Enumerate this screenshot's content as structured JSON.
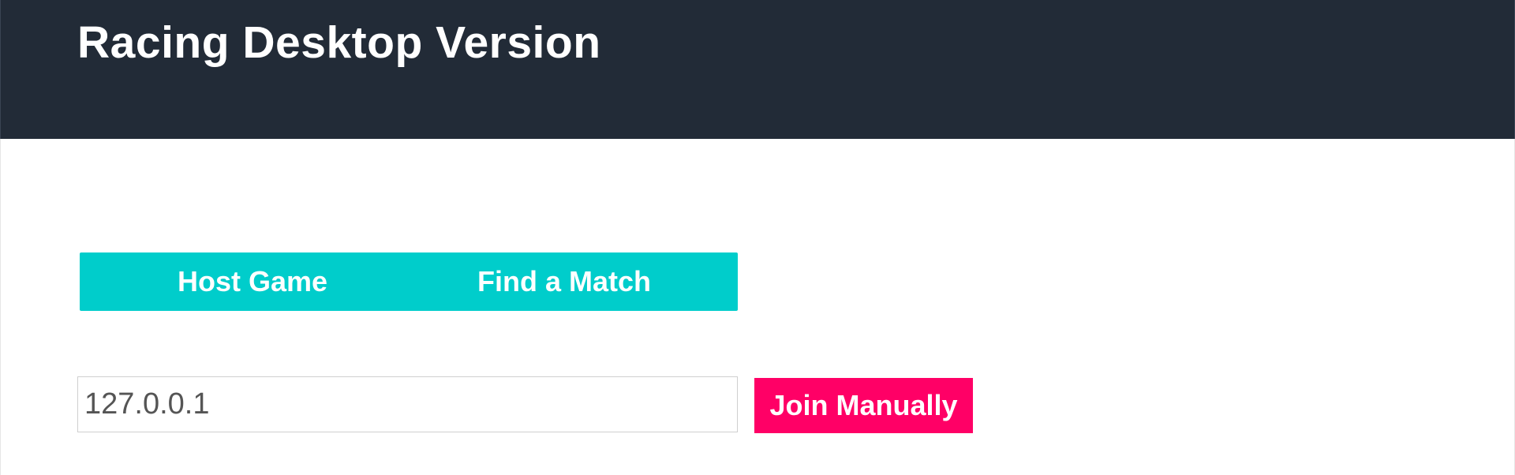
{
  "header": {
    "title": "Racing Desktop Version"
  },
  "actions": {
    "host_label": "Host Game",
    "find_label": "Find a Match"
  },
  "manual_join": {
    "ip_value": "127.0.0.1",
    "join_label": "Join Manually"
  },
  "colors": {
    "header_bg": "#222b37",
    "primary_teal": "#00cdcb",
    "accent_pink": "#ff0066"
  }
}
